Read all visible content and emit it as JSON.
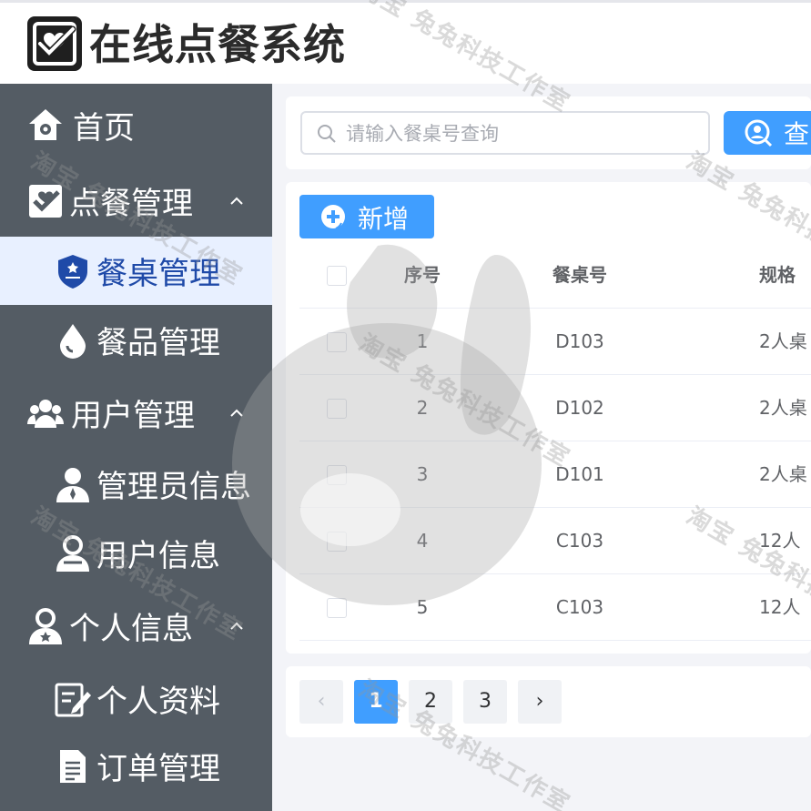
{
  "header": {
    "title": "在线点餐系统",
    "logo_icon": "heart-check-icon"
  },
  "sidebar": {
    "items": [
      {
        "key": "home",
        "label": "首页",
        "icon": "home-icon",
        "level": 0
      },
      {
        "key": "order-mgmt",
        "label": "点餐管理",
        "icon": "checkbox-icon",
        "level": 0,
        "expanded": true
      },
      {
        "key": "table-mgmt",
        "label": "餐桌管理",
        "icon": "shield-icon",
        "level": 1,
        "active": true
      },
      {
        "key": "dish-mgmt",
        "label": "餐品管理",
        "icon": "drop-icon",
        "level": 1
      },
      {
        "key": "user-mgmt",
        "label": "用户管理",
        "icon": "users-icon",
        "level": 0,
        "expanded": true
      },
      {
        "key": "admin-info",
        "label": "管理员信息",
        "icon": "admin-user-icon",
        "level": 1
      },
      {
        "key": "user-info",
        "label": "用户信息",
        "icon": "user-icon",
        "level": 1
      },
      {
        "key": "personal",
        "label": "个人信息",
        "icon": "person-star-icon",
        "level": 0,
        "expanded": true
      },
      {
        "key": "profile",
        "label": "个人资料",
        "icon": "edit-note-icon",
        "level": 1
      },
      {
        "key": "orders",
        "label": "订单管理",
        "icon": "document-icon",
        "level": 1
      }
    ]
  },
  "search": {
    "placeholder": "请输入餐桌号查询",
    "value": "",
    "button_label": "查"
  },
  "toolbar": {
    "add_label": "新增"
  },
  "table": {
    "columns": [
      "序号",
      "餐桌号",
      "规格"
    ],
    "rows": [
      {
        "idx": "1",
        "no": "D103",
        "spec": "2人桌"
      },
      {
        "idx": "2",
        "no": "D102",
        "spec": "2人桌"
      },
      {
        "idx": "3",
        "no": "D101",
        "spec": "2人桌"
      },
      {
        "idx": "4",
        "no": "C103",
        "spec": "12人"
      },
      {
        "idx": "5",
        "no": "C103",
        "spec": "12人"
      }
    ]
  },
  "pagination": {
    "prev": "‹",
    "next": "›",
    "pages": [
      "1",
      "2",
      "3"
    ],
    "current": "1"
  },
  "watermark": {
    "text": "淘宝 兔兔科技工作室"
  },
  "colors": {
    "primary": "#409eff",
    "sidebar_bg": "#545c64",
    "active_bg": "#e8f0ff",
    "active_text": "#1f4aa8"
  }
}
